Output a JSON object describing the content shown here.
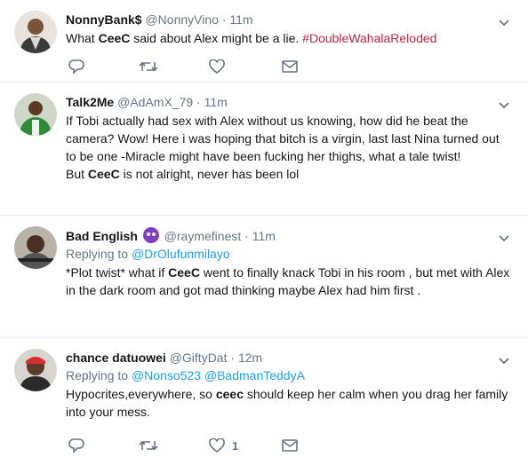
{
  "colors": {
    "link": "#1da1f2",
    "hashtag": "#c0263f",
    "muted": "#657786",
    "divider": "#e6ecf0"
  },
  "tweets": [
    {
      "name": "NonnyBank$",
      "handle": "@NonnyVino",
      "time": "11m",
      "text_before": "What ",
      "text_bold": "CeeC",
      "text_after": " said about Alex might be a lie.  ",
      "hashtag": "#DoubleWahalaReloded",
      "actions": [
        "reply-icon",
        "retweet-icon",
        "like-icon",
        "dm-icon"
      ]
    },
    {
      "name": "Talk2Me",
      "handle": "@AdAmX_79",
      "time": "11m",
      "line1": "If Tobi actually had sex with Alex without us knowing, how did he beat the camera? Wow! Here i was hoping that bitch is a virgin, last last Nina turned out to be one -Miracle might have been fucking her thighs, what a tale twist!",
      "line2_before": "But ",
      "line2_bold": "CeeC",
      "line2_after": " is not alright, never has been lol"
    },
    {
      "name": "Bad English",
      "handle": "@raymefinest",
      "time": "11m",
      "replying_label": "Replying to ",
      "replying_to": "@DrOlufunmilayo",
      "text_before": "*Plot twist* what if ",
      "text_bold": "CeeC",
      "text_after": " went to finally knack Tobi in his room , but met with Alex in the dark room and got mad thinking maybe Alex had him first ."
    },
    {
      "name": "chance datuowei",
      "handle": "@GiftyDat",
      "time": "12m",
      "replying_label": "Replying to ",
      "replying_to": "@Nonso523",
      "replying_to_2": "@BadmanTeddyA",
      "text_before": "Hypocrites,everywhere, so ",
      "text_bold": "ceec",
      "text_after": " should keep her calm when you drag her family into your mess.",
      "like_count": "1"
    }
  ],
  "separator": "·"
}
